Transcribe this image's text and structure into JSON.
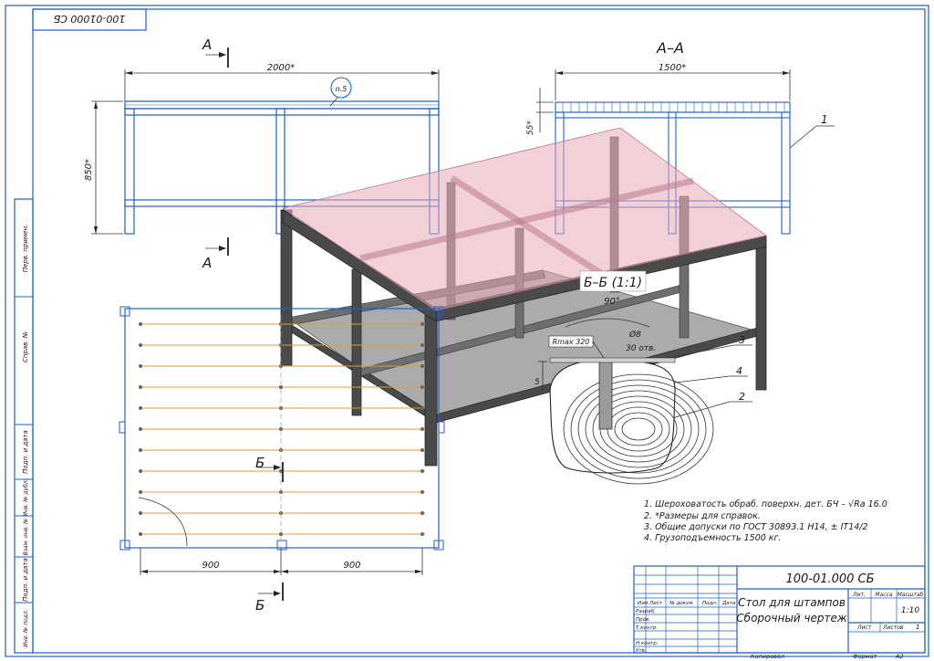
{
  "stamp_top": "100-01000 СБ",
  "section_a_marker": "А",
  "section_aa_title": "А–А",
  "section_bb_title": "Б–Б (1:1)",
  "section_b_marker": "Б",
  "dims": {
    "front_width": "2000*",
    "front_height": "850*",
    "side_width": "1500*",
    "side_top": "55*",
    "plan_left": "900",
    "plan_right": "900",
    "detail_angle": "90°",
    "detail_dia": "Ø8",
    "detail_holes": "30 отв.",
    "detail_rough": "Rmax 320",
    "detail_depth": "5"
  },
  "callout_n5": "n.5",
  "leaders": [
    "1",
    "2",
    "3",
    "4"
  ],
  "notes": [
    "1. Шероховатость обраб. поверхн. дет. БЧ – √Ra 16.0",
    "2. *Размеры для справок.",
    "3. Общие допуски по ГОСТ 30893.1 Н14, ± IT14/2",
    "4. Грузоподъемность 1500 кг."
  ],
  "title_block": {
    "doc_number": "100-01.000 СБ",
    "name_line1": "Стол для штампов",
    "name_line2": "Сборочный чертеж",
    "col_lit": "Лит.",
    "col_mass": "Масса",
    "col_scale": "Масштаб",
    "scale": "1:10",
    "sheet": "Лист",
    "sheets": "Листов",
    "sheets_count": "1",
    "rows": [
      "Изм.",
      "Лист",
      "№ докум.",
      "Подп.",
      "Дата"
    ],
    "roles": [
      "Разраб.",
      "Пров.",
      "Т.контр.",
      "",
      "Н.контр.",
      "Утв."
    ],
    "copied": "Копировал",
    "format_label": "Формат",
    "format": "А2"
  },
  "side_strip": [
    "Перв. примен.",
    "Справ. №",
    "Подп. и дата",
    "Инв. № дубл.",
    "Взам. инв. №",
    "Подп. и дата",
    "Инв. № подл."
  ]
}
